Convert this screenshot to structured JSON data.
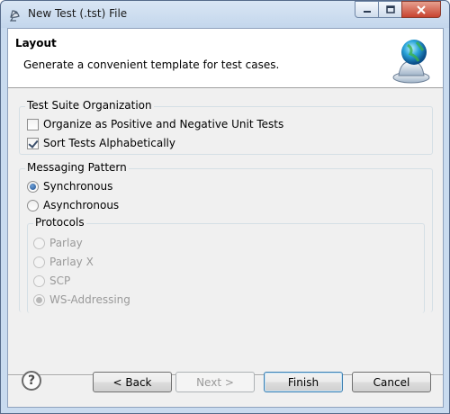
{
  "window": {
    "title": "New Test (.tst) File",
    "controls": {
      "minimize_icon": "minimize-icon",
      "maximize_icon": "maximize-icon",
      "close_icon": "close-icon"
    }
  },
  "banner": {
    "title": "Layout",
    "description": "Generate a convenient template for test cases.",
    "image_icon": "globe-bell-icon"
  },
  "test_suite": {
    "label": "Test Suite Organization",
    "options": [
      {
        "label": "Organize as Positive and Negative Unit Tests",
        "checked": false
      },
      {
        "label": "Sort Tests Alphabetically",
        "checked": true
      }
    ]
  },
  "messaging": {
    "label": "Messaging Pattern",
    "options": [
      {
        "label": "Synchronous",
        "selected": true
      },
      {
        "label": "Asynchronous",
        "selected": false
      }
    ],
    "protocols": {
      "label": "Protocols",
      "options": [
        {
          "label": "Parlay",
          "selected": false
        },
        {
          "label": "Parlay X",
          "selected": false
        },
        {
          "label": "SCP",
          "selected": false
        },
        {
          "label": "WS-Addressing",
          "selected": true
        }
      ]
    }
  },
  "footer": {
    "help_icon": "help-icon",
    "back": "< Back",
    "next": "Next >",
    "finish": "Finish",
    "cancel": "Cancel"
  }
}
